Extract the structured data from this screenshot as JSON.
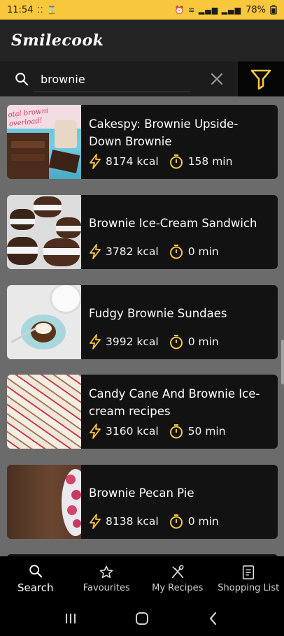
{
  "status": {
    "time": "11:54",
    "battery": "78%"
  },
  "app": {
    "title": "Smilecook"
  },
  "search": {
    "value": "brownie"
  },
  "recipes": [
    {
      "title": "Cakespy: Brownie Upside-Down Brownie",
      "kcal": "8174 kcal",
      "time": "158 min",
      "thumb_text": "otal browni overload!"
    },
    {
      "title": "Brownie Ice-Cream Sandwich",
      "kcal": "3782 kcal",
      "time": "0 min"
    },
    {
      "title": "Fudgy Brownie Sundaes",
      "kcal": "3992 kcal",
      "time": "0 min"
    },
    {
      "title": "Candy Cane And Brownie Ice-cream recipes",
      "kcal": "3160 kcal",
      "time": "50 min"
    },
    {
      "title": "Brownie Pecan Pie",
      "kcal": "8138 kcal",
      "time": "0 min"
    }
  ],
  "nav": {
    "search": "Search",
    "favourites": "Favourites",
    "my_recipes": "My Recipes",
    "shopping_list": "Shopping List"
  },
  "colors": {
    "accent": "#f9c73b",
    "card": "#121212",
    "background": "#6b6b6b"
  },
  "icons": [
    "search-icon",
    "close-icon",
    "filter-icon",
    "bolt-icon",
    "timer-icon",
    "star-icon",
    "utensils-icon",
    "list-icon"
  ]
}
